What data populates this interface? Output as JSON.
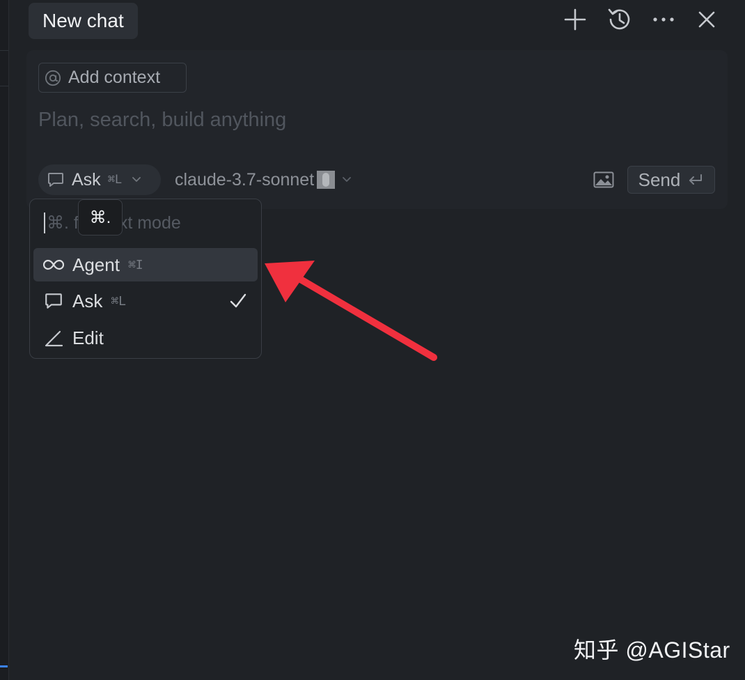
{
  "header": {
    "tab_title": "New chat"
  },
  "composer": {
    "add_context_label": "Add context",
    "prompt_placeholder": "Plan, search, build anything",
    "mode": {
      "label": "Ask",
      "shortcut": "⌘L"
    },
    "model": {
      "label": "claude-3.7-sonnet"
    },
    "send_label": "Send"
  },
  "mode_menu": {
    "search_placeholder_left": "⌘. f",
    "search_placeholder_right": "xt mode",
    "tooltip": "⌘.",
    "items": [
      {
        "label": "Agent",
        "shortcut": "⌘I",
        "active": true
      },
      {
        "label": "Ask",
        "shortcut": "⌘L",
        "checked": true
      },
      {
        "label": "Edit",
        "shortcut": ""
      }
    ]
  },
  "watermark": "知乎 @AGIStar",
  "colors": {
    "background": "#1f2226",
    "annotation_arrow": "#f0303e",
    "accent": "#3b82f6"
  }
}
